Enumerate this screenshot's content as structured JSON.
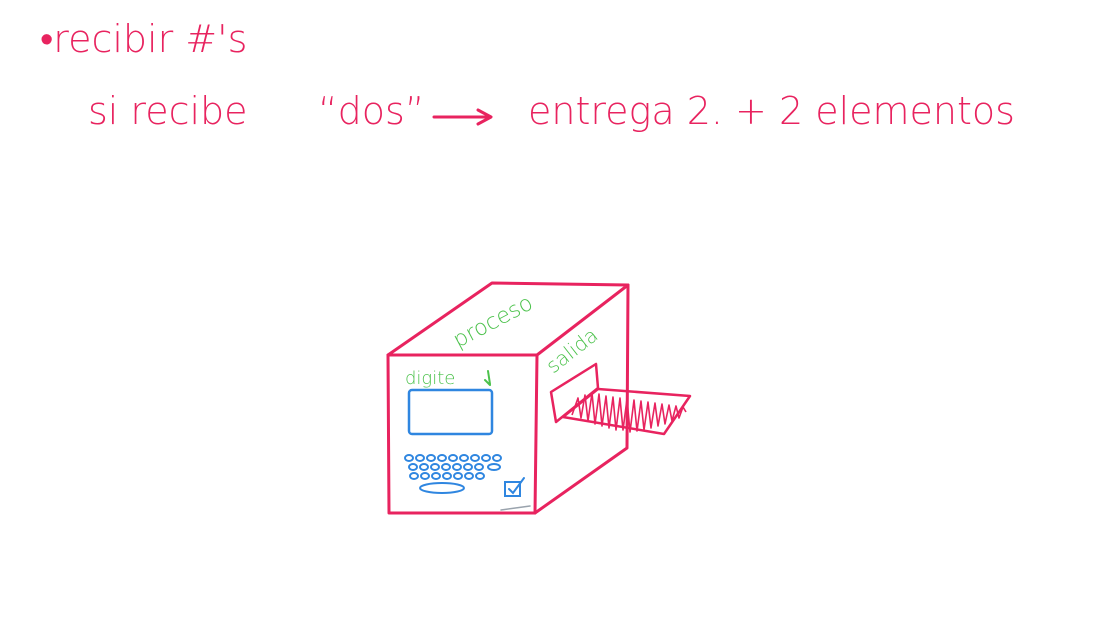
{
  "notes": {
    "line1": "•recibir #'s",
    "line2_prefix": "si recibe",
    "line2_quote": "“dos”",
    "line2_result": "entrega 2. + 2 elementos"
  },
  "machine": {
    "top_label": "proceso",
    "side_label": "salida",
    "front_label": "digite"
  },
  "colors": {
    "pink": "#e8235f",
    "green": "#4cc24c",
    "blue": "#2f86e0"
  }
}
